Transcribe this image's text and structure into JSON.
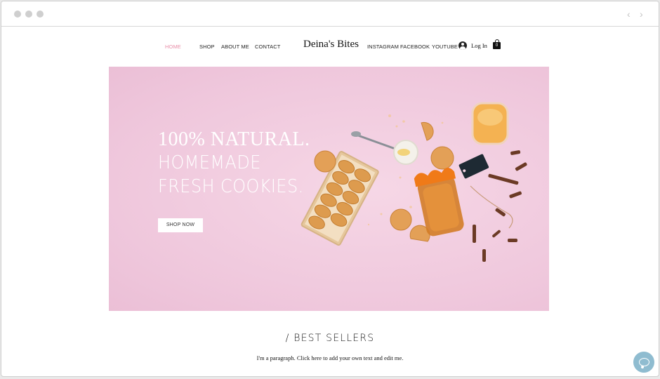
{
  "browser": {
    "back_icon": "chevron-left-icon",
    "forward_icon": "chevron-right-icon",
    "back_glyph": "‹",
    "forward_glyph": "›"
  },
  "header": {
    "nav_left": [
      "HOME",
      "SHOP",
      "ABOUT ME",
      "CONTACT"
    ],
    "active_item": "HOME",
    "logo": "Deina's Bites",
    "nav_right": [
      "INSTAGRAM",
      "FACEBOOK",
      "YOUTUBE"
    ],
    "login_label": "Log In",
    "cart_count": "0"
  },
  "hero": {
    "line1": "100% NATURAL.",
    "line2": "HOMEMADE",
    "line3": "FRESH COOKIES.",
    "cta_label": "SHOP NOW"
  },
  "section": {
    "title": "/ BEST SELLERS",
    "paragraph": "I'm a paragraph. Click here to add your own text and edit me."
  },
  "colors": {
    "accent_pink": "#e88ea8",
    "hero_bg": "#efc7dc",
    "chat_bubble": "#8fbcd0"
  }
}
